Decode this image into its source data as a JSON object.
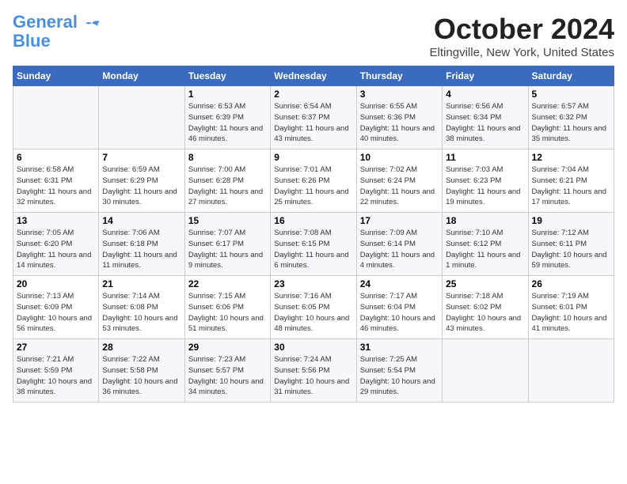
{
  "header": {
    "logo_general": "General",
    "logo_blue": "Blue",
    "month_title": "October 2024",
    "location": "Eltingville, New York, United States"
  },
  "days_of_week": [
    "Sunday",
    "Monday",
    "Tuesday",
    "Wednesday",
    "Thursday",
    "Friday",
    "Saturday"
  ],
  "weeks": [
    [
      {
        "day": "",
        "info": ""
      },
      {
        "day": "",
        "info": ""
      },
      {
        "day": "1",
        "info": "Sunrise: 6:53 AM\nSunset: 6:39 PM\nDaylight: 11 hours and 46 minutes."
      },
      {
        "day": "2",
        "info": "Sunrise: 6:54 AM\nSunset: 6:37 PM\nDaylight: 11 hours and 43 minutes."
      },
      {
        "day": "3",
        "info": "Sunrise: 6:55 AM\nSunset: 6:36 PM\nDaylight: 11 hours and 40 minutes."
      },
      {
        "day": "4",
        "info": "Sunrise: 6:56 AM\nSunset: 6:34 PM\nDaylight: 11 hours and 38 minutes."
      },
      {
        "day": "5",
        "info": "Sunrise: 6:57 AM\nSunset: 6:32 PM\nDaylight: 11 hours and 35 minutes."
      }
    ],
    [
      {
        "day": "6",
        "info": "Sunrise: 6:58 AM\nSunset: 6:31 PM\nDaylight: 11 hours and 32 minutes."
      },
      {
        "day": "7",
        "info": "Sunrise: 6:59 AM\nSunset: 6:29 PM\nDaylight: 11 hours and 30 minutes."
      },
      {
        "day": "8",
        "info": "Sunrise: 7:00 AM\nSunset: 6:28 PM\nDaylight: 11 hours and 27 minutes."
      },
      {
        "day": "9",
        "info": "Sunrise: 7:01 AM\nSunset: 6:26 PM\nDaylight: 11 hours and 25 minutes."
      },
      {
        "day": "10",
        "info": "Sunrise: 7:02 AM\nSunset: 6:24 PM\nDaylight: 11 hours and 22 minutes."
      },
      {
        "day": "11",
        "info": "Sunrise: 7:03 AM\nSunset: 6:23 PM\nDaylight: 11 hours and 19 minutes."
      },
      {
        "day": "12",
        "info": "Sunrise: 7:04 AM\nSunset: 6:21 PM\nDaylight: 11 hours and 17 minutes."
      }
    ],
    [
      {
        "day": "13",
        "info": "Sunrise: 7:05 AM\nSunset: 6:20 PM\nDaylight: 11 hours and 14 minutes."
      },
      {
        "day": "14",
        "info": "Sunrise: 7:06 AM\nSunset: 6:18 PM\nDaylight: 11 hours and 11 minutes."
      },
      {
        "day": "15",
        "info": "Sunrise: 7:07 AM\nSunset: 6:17 PM\nDaylight: 11 hours and 9 minutes."
      },
      {
        "day": "16",
        "info": "Sunrise: 7:08 AM\nSunset: 6:15 PM\nDaylight: 11 hours and 6 minutes."
      },
      {
        "day": "17",
        "info": "Sunrise: 7:09 AM\nSunset: 6:14 PM\nDaylight: 11 hours and 4 minutes."
      },
      {
        "day": "18",
        "info": "Sunrise: 7:10 AM\nSunset: 6:12 PM\nDaylight: 11 hours and 1 minute."
      },
      {
        "day": "19",
        "info": "Sunrise: 7:12 AM\nSunset: 6:11 PM\nDaylight: 10 hours and 59 minutes."
      }
    ],
    [
      {
        "day": "20",
        "info": "Sunrise: 7:13 AM\nSunset: 6:09 PM\nDaylight: 10 hours and 56 minutes."
      },
      {
        "day": "21",
        "info": "Sunrise: 7:14 AM\nSunset: 6:08 PM\nDaylight: 10 hours and 53 minutes."
      },
      {
        "day": "22",
        "info": "Sunrise: 7:15 AM\nSunset: 6:06 PM\nDaylight: 10 hours and 51 minutes."
      },
      {
        "day": "23",
        "info": "Sunrise: 7:16 AM\nSunset: 6:05 PM\nDaylight: 10 hours and 48 minutes."
      },
      {
        "day": "24",
        "info": "Sunrise: 7:17 AM\nSunset: 6:04 PM\nDaylight: 10 hours and 46 minutes."
      },
      {
        "day": "25",
        "info": "Sunrise: 7:18 AM\nSunset: 6:02 PM\nDaylight: 10 hours and 43 minutes."
      },
      {
        "day": "26",
        "info": "Sunrise: 7:19 AM\nSunset: 6:01 PM\nDaylight: 10 hours and 41 minutes."
      }
    ],
    [
      {
        "day": "27",
        "info": "Sunrise: 7:21 AM\nSunset: 5:59 PM\nDaylight: 10 hours and 38 minutes."
      },
      {
        "day": "28",
        "info": "Sunrise: 7:22 AM\nSunset: 5:58 PM\nDaylight: 10 hours and 36 minutes."
      },
      {
        "day": "29",
        "info": "Sunrise: 7:23 AM\nSunset: 5:57 PM\nDaylight: 10 hours and 34 minutes."
      },
      {
        "day": "30",
        "info": "Sunrise: 7:24 AM\nSunset: 5:56 PM\nDaylight: 10 hours and 31 minutes."
      },
      {
        "day": "31",
        "info": "Sunrise: 7:25 AM\nSunset: 5:54 PM\nDaylight: 10 hours and 29 minutes."
      },
      {
        "day": "",
        "info": ""
      },
      {
        "day": "",
        "info": ""
      }
    ]
  ]
}
